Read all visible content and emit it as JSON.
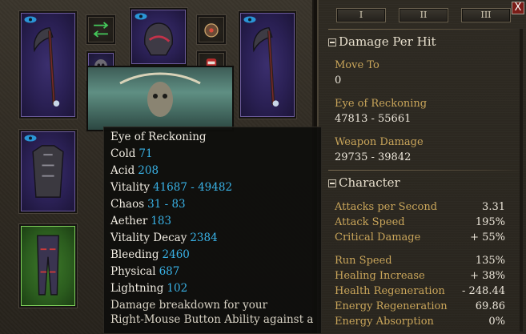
{
  "equipment": {
    "slots": [
      {
        "id": "weapon-left",
        "state": "purple",
        "icon": "scythe-icon"
      },
      {
        "id": "swap",
        "state": "dark",
        "icon": "weapon-swap-icon"
      },
      {
        "id": "helmet",
        "state": "purple",
        "icon": "helmet-icon"
      },
      {
        "id": "amulet",
        "state": "dark",
        "icon": "amulet-icon"
      },
      {
        "id": "shoulders",
        "state": "small",
        "icon": "skull-shoulders-icon"
      },
      {
        "id": "medal",
        "state": "dark",
        "icon": "medal-icon"
      },
      {
        "id": "weapon-right",
        "state": "purple",
        "icon": "scythe-icon"
      },
      {
        "id": "chest",
        "state": "purple",
        "icon": "chest-armor-icon"
      },
      {
        "id": "legs",
        "state": "green",
        "icon": "leg-armor-icon"
      }
    ]
  },
  "tabs": [
    "I",
    "II",
    "III"
  ],
  "close_label": "X",
  "stats": {
    "damage_per_hit": {
      "title": "Damage Per Hit",
      "entries": [
        {
          "label": "Move To",
          "value": "0"
        },
        {
          "label": "Eye of Reckoning",
          "value": "47813 - 55661"
        },
        {
          "label": "Weapon Damage",
          "value": "29735 - 39842"
        }
      ]
    },
    "character": {
      "title": "Character",
      "group1": [
        {
          "label": "Attacks per Second",
          "value": "3.31"
        },
        {
          "label": "Attack Speed",
          "value": "195%"
        },
        {
          "label": "Critical Damage",
          "value": "+ 55%"
        }
      ],
      "group2": [
        {
          "label": "Run Speed",
          "value": "135%"
        },
        {
          "label": "Healing Increase",
          "value": "+ 38%"
        },
        {
          "label": "Health Regeneration",
          "value": "- 248.44"
        },
        {
          "label": "Energy Regeneration",
          "value": "69.86"
        },
        {
          "label": "Energy Absorption",
          "value": "0%"
        }
      ]
    }
  },
  "tooltip": {
    "title": "Eye of Reckoning",
    "lines": [
      {
        "label": "Cold",
        "value": "71"
      },
      {
        "label": "Acid",
        "value": "208"
      },
      {
        "label": "Vitality",
        "value": "41687 - 49482"
      },
      {
        "label": "Chaos",
        "value": "31 - 83"
      },
      {
        "label": "Aether",
        "value": "183"
      },
      {
        "label": "Vitality Decay",
        "value": "2384"
      },
      {
        "label": "Bleeding",
        "value": "2460"
      },
      {
        "label": "Physical",
        "value": "687"
      },
      {
        "label": "Lightning",
        "value": "102"
      }
    ],
    "description_1": "Damage breakdown for your",
    "description_2": "Right-Mouse Button Ability against a"
  },
  "colors": {
    "label_gold": "#c9a55a",
    "value_white": "#ece6da",
    "tooltip_number_blue": "#39b2e6",
    "rare_purple": "#2a2054",
    "magic_green": "#2b5c1e"
  }
}
